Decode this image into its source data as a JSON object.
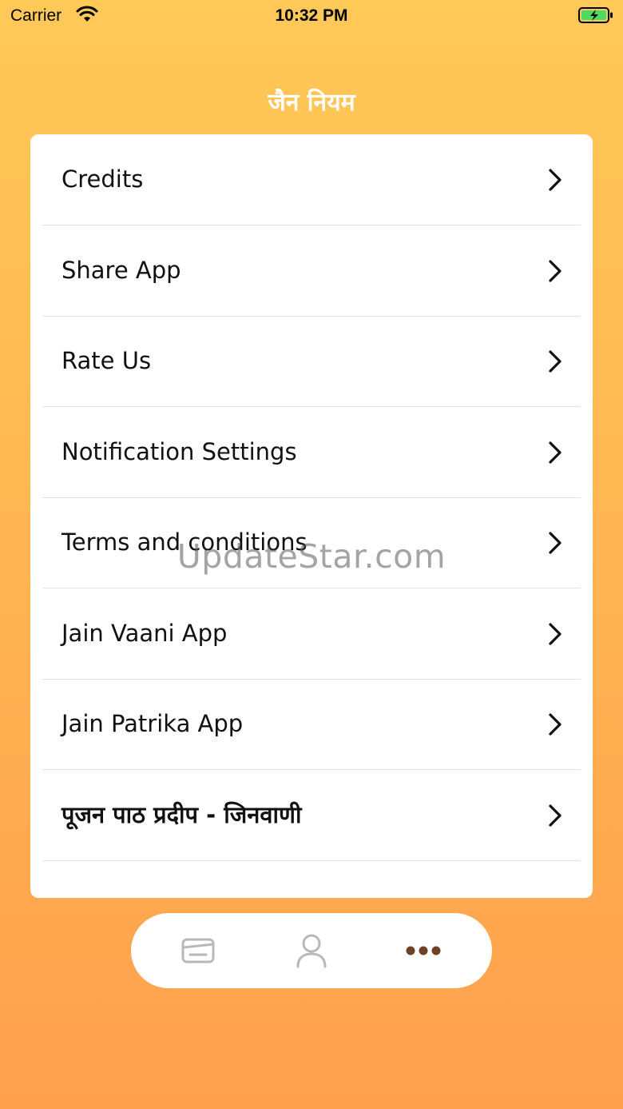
{
  "status_bar": {
    "carrier": "Carrier",
    "time": "10:32 PM",
    "wifi_icon": "wifi-icon",
    "battery_icon": "battery-charging-icon"
  },
  "header": {
    "title": "जैन नियम"
  },
  "menu": {
    "items": [
      {
        "label": "Credits",
        "icon": "chevron-right-icon"
      },
      {
        "label": "Share App",
        "icon": "chevron-right-icon"
      },
      {
        "label": "Rate Us",
        "icon": "chevron-right-icon"
      },
      {
        "label": "Notification Settings",
        "icon": "chevron-right-icon"
      },
      {
        "label": "Terms and conditions",
        "icon": "chevron-right-icon"
      },
      {
        "label": "Jain Vaani App",
        "icon": "chevron-right-icon"
      },
      {
        "label": "Jain Patrika App",
        "icon": "chevron-right-icon"
      },
      {
        "label": "पूजन पाठ प्रदीप - जिनवाणी",
        "icon": "chevron-right-icon"
      }
    ]
  },
  "watermark": "UpdateStar.com",
  "tab_bar": {
    "tabs": [
      {
        "icon": "inbox-icon",
        "selected": false
      },
      {
        "icon": "profile-icon",
        "selected": false
      },
      {
        "icon": "more-icon",
        "selected": true
      }
    ]
  },
  "colors": {
    "background_top": "#FFC958",
    "background_bottom": "#FFA04E",
    "tab_inactive": "#B8B8B8",
    "tab_active": "#6B4226",
    "separator": "#E2E2E2"
  }
}
